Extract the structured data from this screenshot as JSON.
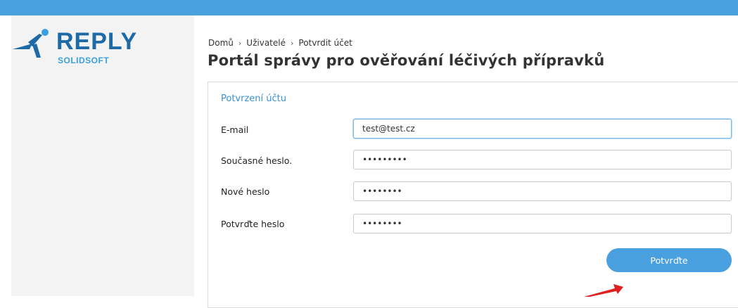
{
  "logo": {
    "name": "REPLY",
    "sub": "SOLIDSOFT"
  },
  "breadcrumb": {
    "items": [
      "Domů",
      "Uživatelé",
      "Potvrdit účet"
    ],
    "separator": "›"
  },
  "page": {
    "title": "Portál správy pro ověřování léčivých přípravků"
  },
  "form": {
    "title": "Potvrzení účtu",
    "fields": [
      {
        "label": "E-mail",
        "value": "test@test.cz"
      },
      {
        "label": "Současné heslo.",
        "value": "•••••••••"
      },
      {
        "label": "Nové heslo",
        "value": "••••••••"
      },
      {
        "label": "Potvrďte heslo",
        "value": "••••••••"
      }
    ],
    "submit_label": "Potvrďte"
  },
  "colors": {
    "topbar": "#4a9fdf",
    "accent": "#3a8fd0",
    "button": "#4a9fdf",
    "annotation_arrow": "#e02020"
  },
  "icons": {
    "logo_mark": "running-figure-icon",
    "breadcrumb_separator": "chevron-right-icon",
    "annotation": "red-arrow-annotation"
  }
}
